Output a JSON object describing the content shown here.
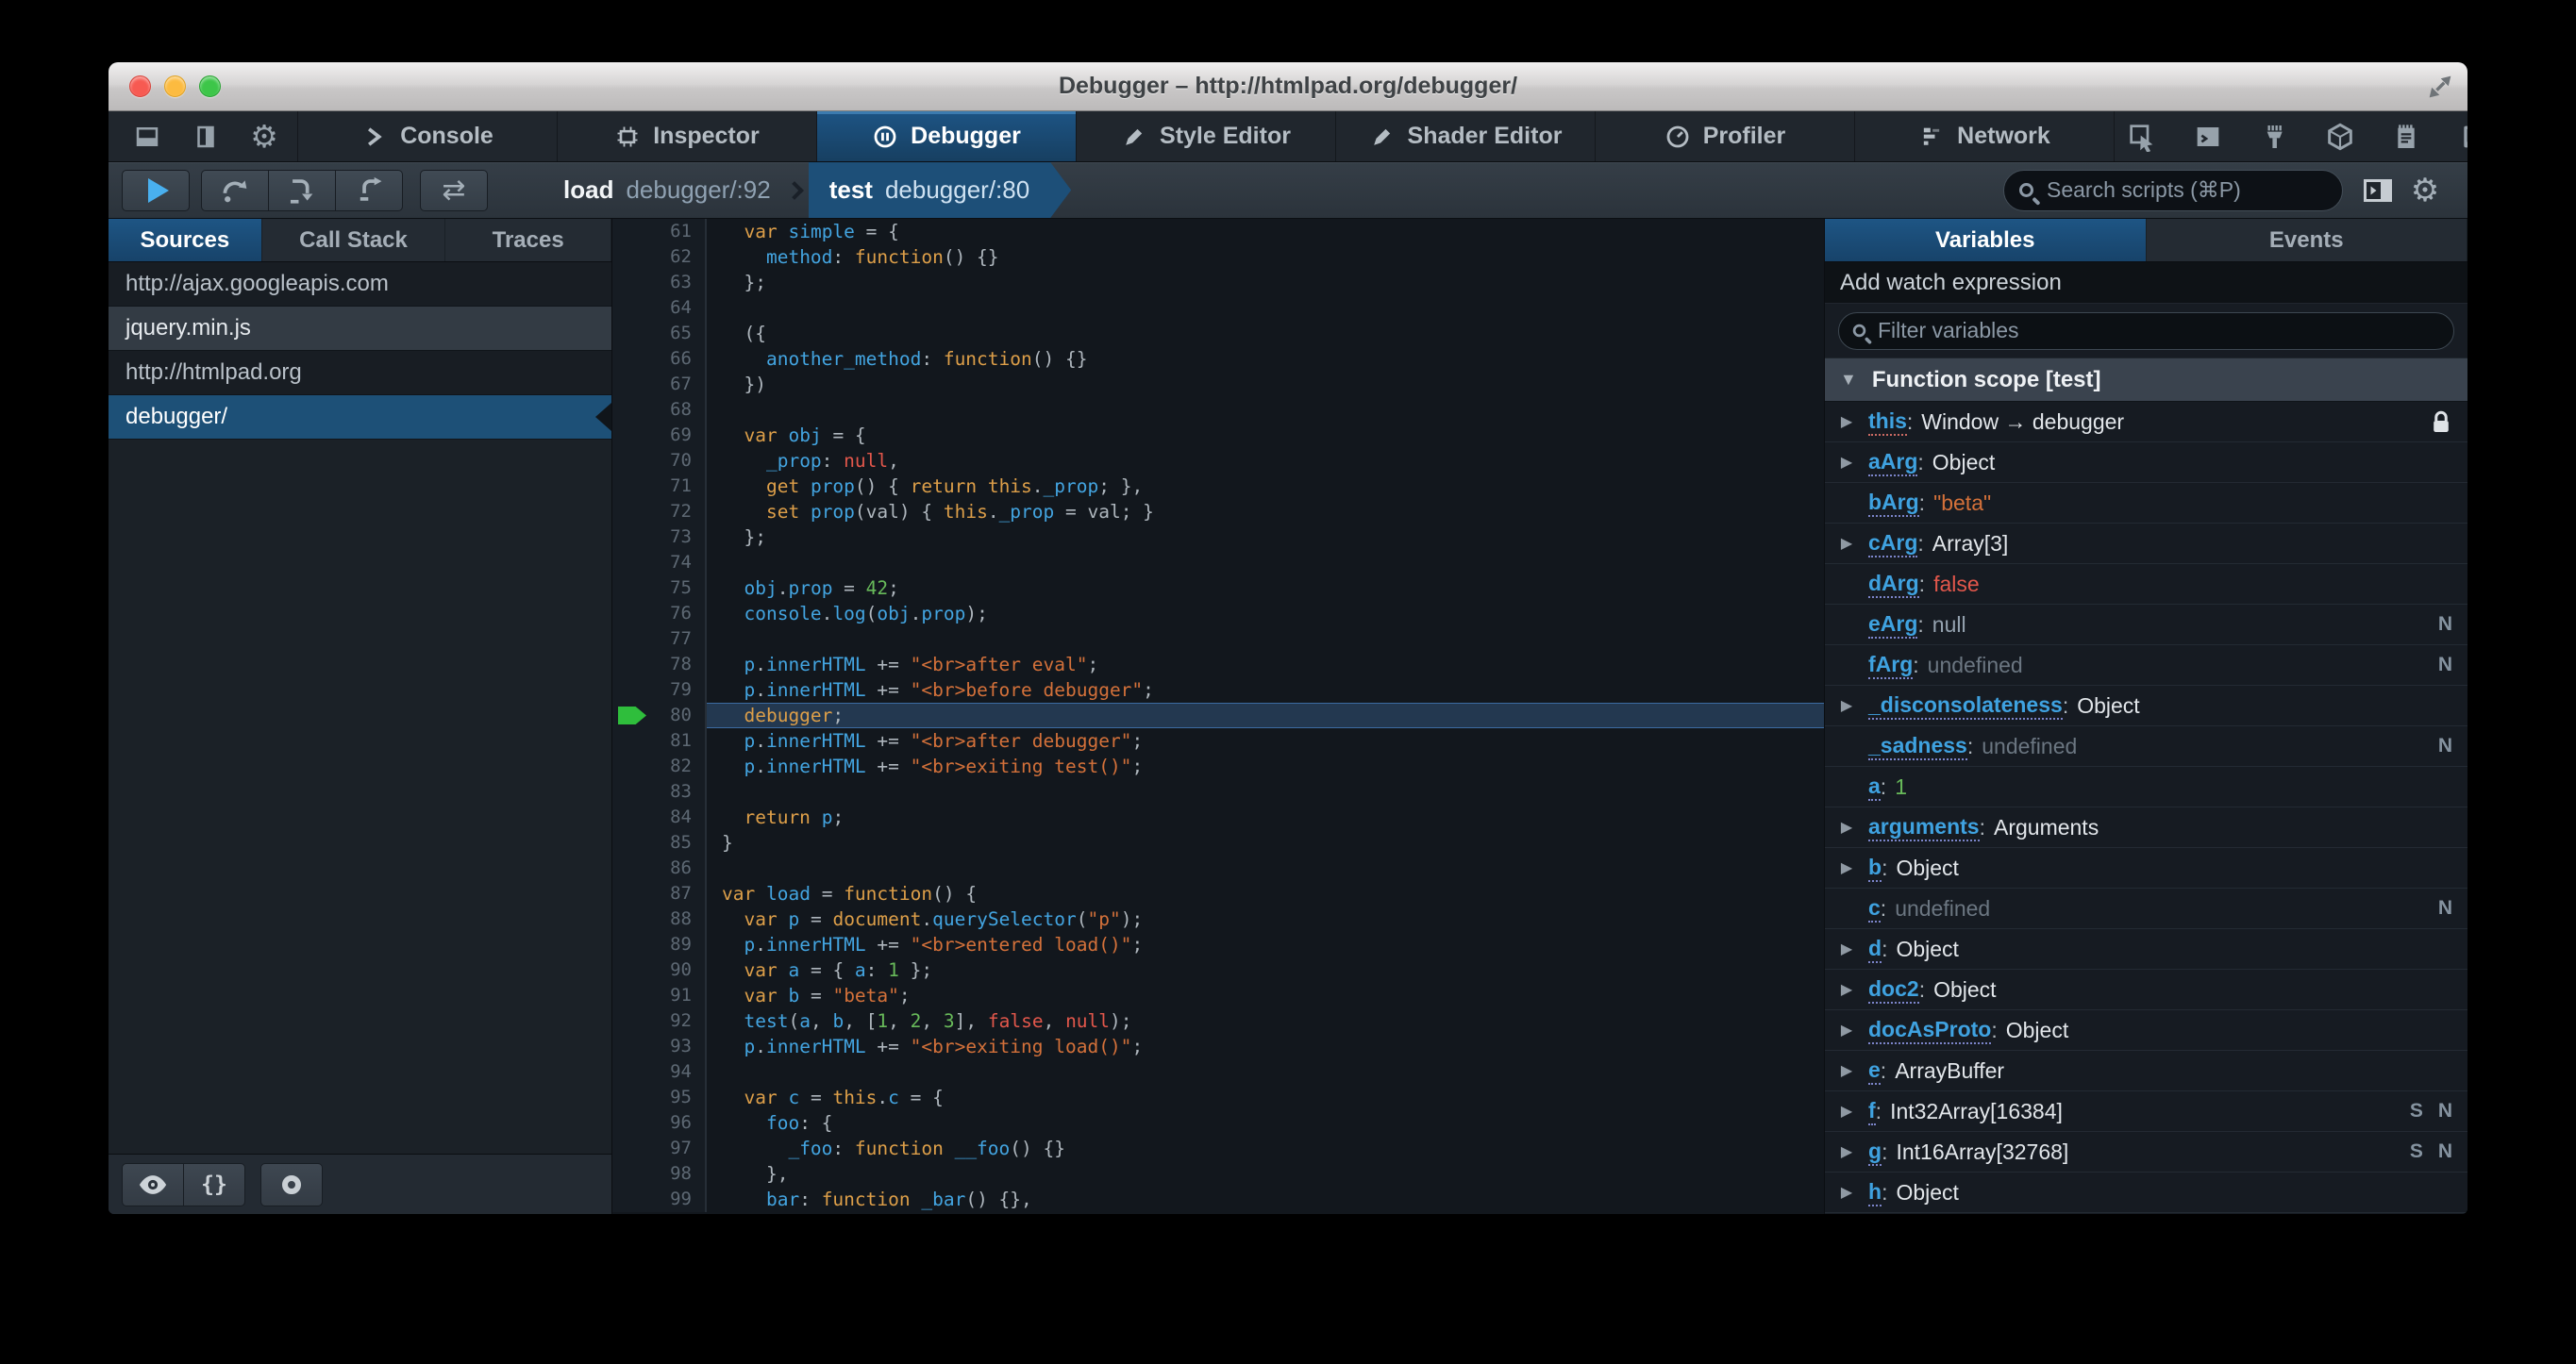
{
  "window": {
    "title": "Debugger – http://htmlpad.org/debugger/"
  },
  "colors": {
    "accent_blue": "#1d5077",
    "tab_blue": "#1d5484",
    "paused_green": "#2fbe3c",
    "keyword": "#dd9f49",
    "identifier": "#43a4e0",
    "string": "#d4713a",
    "number": "#68ba5a",
    "atom": "#e2574b"
  },
  "toolbar": {
    "left_buttons": [
      {
        "icon": "dock-bottom-icon"
      },
      {
        "icon": "dock-side-icon"
      },
      {
        "icon": "gear-icon"
      }
    ],
    "tabs": [
      {
        "id": "console",
        "label": "Console",
        "icon": "console-icon",
        "active": false
      },
      {
        "id": "inspector",
        "label": "Inspector",
        "icon": "inspector-icon",
        "active": false
      },
      {
        "id": "debugger",
        "label": "Debugger",
        "icon": "debugger-icon",
        "active": true
      },
      {
        "id": "style-editor",
        "label": "Style Editor",
        "icon": "style-editor-icon",
        "active": false
      },
      {
        "id": "shader-editor",
        "label": "Shader Editor",
        "icon": "shader-editor-icon",
        "active": false
      },
      {
        "id": "profiler",
        "label": "Profiler",
        "icon": "profiler-icon",
        "active": false
      },
      {
        "id": "network",
        "label": "Network",
        "icon": "network-icon",
        "active": false
      }
    ],
    "right_buttons": [
      {
        "icon": "pick-element-icon"
      },
      {
        "icon": "split-console-icon"
      },
      {
        "icon": "clean-icon"
      },
      {
        "icon": "tilt-3d-icon"
      },
      {
        "icon": "scratchpad-icon"
      },
      {
        "icon": "responsive-mode-icon"
      }
    ]
  },
  "debug_toolbar": {
    "resume_icon": "resume-icon",
    "step_buttons": [
      {
        "icon": "step-over-icon"
      },
      {
        "icon": "step-in-icon"
      },
      {
        "icon": "step-out-icon"
      }
    ],
    "toggle_icon": "swap-arrows-icon",
    "breadcrumbs": [
      {
        "fn": "load",
        "loc": "debugger/:92",
        "active": false
      },
      {
        "fn": "test",
        "loc": "debugger/:80",
        "active": true
      }
    ],
    "search": {
      "placeholder": "Search scripts (⌘P)"
    },
    "right_buttons": [
      {
        "icon": "panel-toggle-icon"
      },
      {
        "icon": "gear-icon"
      }
    ]
  },
  "sources_panel": {
    "tabs": [
      {
        "label": "Sources",
        "active": true
      },
      {
        "label": "Call Stack",
        "active": false
      },
      {
        "label": "Traces",
        "active": false
      }
    ],
    "items": [
      {
        "label": "http://ajax.googleapis.com",
        "kind": "group",
        "selected": false
      },
      {
        "label": "jquery.min.js",
        "kind": "file",
        "selected": false
      },
      {
        "label": "http://htmlpad.org",
        "kind": "group",
        "selected": false
      },
      {
        "label": "debugger/",
        "kind": "file",
        "selected": true
      }
    ],
    "footer_buttons": [
      {
        "icon": "blackbox-eye-icon",
        "glyph": ""
      },
      {
        "icon": "pretty-print-icon",
        "glyph": "{}"
      },
      {
        "icon": "record-icon",
        "glyph": ""
      }
    ]
  },
  "editor": {
    "first_line": 61,
    "paused_line": 80,
    "lines": [
      [
        [
          "pl",
          "  "
        ],
        [
          "kw",
          "var"
        ],
        [
          "pl",
          " "
        ],
        [
          "id",
          "simple"
        ],
        [
          "pu",
          " = {"
        ]
      ],
      [
        [
          "pl",
          "    "
        ],
        [
          "id",
          "method"
        ],
        [
          "pu",
          ": "
        ],
        [
          "kw",
          "function"
        ],
        [
          "pu",
          "() {}"
        ]
      ],
      [
        [
          "pl",
          "  "
        ],
        [
          "pu",
          "};"
        ]
      ],
      [],
      [
        [
          "pl",
          "  "
        ],
        [
          "pu",
          "({"
        ]
      ],
      [
        [
          "pl",
          "    "
        ],
        [
          "id",
          "another_method"
        ],
        [
          "pu",
          ": "
        ],
        [
          "kw",
          "function"
        ],
        [
          "pu",
          "() {}"
        ]
      ],
      [
        [
          "pl",
          "  "
        ],
        [
          "pu",
          "})"
        ]
      ],
      [],
      [
        [
          "pl",
          "  "
        ],
        [
          "kw",
          "var"
        ],
        [
          "pl",
          " "
        ],
        [
          "id",
          "obj"
        ],
        [
          "pu",
          " = {"
        ]
      ],
      [
        [
          "pl",
          "    "
        ],
        [
          "id",
          "_prop"
        ],
        [
          "pu",
          ": "
        ],
        [
          "at",
          "null"
        ],
        [
          "pu",
          ","
        ]
      ],
      [
        [
          "pl",
          "    "
        ],
        [
          "kw",
          "get"
        ],
        [
          "pl",
          " "
        ],
        [
          "id",
          "prop"
        ],
        [
          "pu",
          "() { "
        ],
        [
          "kw",
          "return"
        ],
        [
          "pl",
          " "
        ],
        [
          "kw",
          "this"
        ],
        [
          "pu",
          "."
        ],
        [
          "id",
          "_prop"
        ],
        [
          "pu",
          "; },"
        ]
      ],
      [
        [
          "pl",
          "    "
        ],
        [
          "kw",
          "set"
        ],
        [
          "pl",
          " "
        ],
        [
          "id",
          "prop"
        ],
        [
          "pu",
          "(val) { "
        ],
        [
          "kw",
          "this"
        ],
        [
          "pu",
          "."
        ],
        [
          "id",
          "_prop"
        ],
        [
          "pu",
          " = val; }"
        ]
      ],
      [
        [
          "pl",
          "  "
        ],
        [
          "pu",
          "};"
        ]
      ],
      [],
      [
        [
          "pl",
          "  "
        ],
        [
          "id",
          "obj"
        ],
        [
          "pu",
          "."
        ],
        [
          "id",
          "prop"
        ],
        [
          "pu",
          " = "
        ],
        [
          "nu",
          "42"
        ],
        [
          "pu",
          ";"
        ]
      ],
      [
        [
          "pl",
          "  "
        ],
        [
          "id",
          "console"
        ],
        [
          "pu",
          "."
        ],
        [
          "id",
          "log"
        ],
        [
          "pu",
          "("
        ],
        [
          "id",
          "obj"
        ],
        [
          "pu",
          "."
        ],
        [
          "id",
          "prop"
        ],
        [
          "pu",
          ");"
        ]
      ],
      [],
      [
        [
          "pl",
          "  "
        ],
        [
          "id",
          "p"
        ],
        [
          "pu",
          "."
        ],
        [
          "id",
          "innerHTML"
        ],
        [
          "pu",
          " += "
        ],
        [
          "st",
          "\"<br>after eval\""
        ],
        [
          "pu",
          ";"
        ]
      ],
      [
        [
          "pl",
          "  "
        ],
        [
          "id",
          "p"
        ],
        [
          "pu",
          "."
        ],
        [
          "id",
          "innerHTML"
        ],
        [
          "pu",
          " += "
        ],
        [
          "st",
          "\"<br>before debugger\""
        ],
        [
          "pu",
          ";"
        ]
      ],
      [
        [
          "pl",
          "  "
        ],
        [
          "kw",
          "debugger"
        ],
        [
          "pu",
          ";"
        ]
      ],
      [
        [
          "pl",
          "  "
        ],
        [
          "id",
          "p"
        ],
        [
          "pu",
          "."
        ],
        [
          "id",
          "innerHTML"
        ],
        [
          "pu",
          " += "
        ],
        [
          "st",
          "\"<br>after debugger\""
        ],
        [
          "pu",
          ";"
        ]
      ],
      [
        [
          "pl",
          "  "
        ],
        [
          "id",
          "p"
        ],
        [
          "pu",
          "."
        ],
        [
          "id",
          "innerHTML"
        ],
        [
          "pu",
          " += "
        ],
        [
          "st",
          "\"<br>exiting test()\""
        ],
        [
          "pu",
          ";"
        ]
      ],
      [],
      [
        [
          "pl",
          "  "
        ],
        [
          "kw",
          "return"
        ],
        [
          "pl",
          " "
        ],
        [
          "id",
          "p"
        ],
        [
          "pu",
          ";"
        ]
      ],
      [
        [
          "pu",
          "}"
        ]
      ],
      [],
      [
        [
          "kw",
          "var"
        ],
        [
          "pl",
          " "
        ],
        [
          "id",
          "load"
        ],
        [
          "pu",
          " = "
        ],
        [
          "kw",
          "function"
        ],
        [
          "pu",
          "() {"
        ]
      ],
      [
        [
          "pl",
          "  "
        ],
        [
          "kw",
          "var"
        ],
        [
          "pl",
          " "
        ],
        [
          "id",
          "p"
        ],
        [
          "pu",
          " = "
        ],
        [
          "kw",
          "document"
        ],
        [
          "pu",
          "."
        ],
        [
          "id",
          "querySelector"
        ],
        [
          "pu",
          "("
        ],
        [
          "st",
          "\"p\""
        ],
        [
          "pu",
          ");"
        ]
      ],
      [
        [
          "pl",
          "  "
        ],
        [
          "id",
          "p"
        ],
        [
          "pu",
          "."
        ],
        [
          "id",
          "innerHTML"
        ],
        [
          "pu",
          " += "
        ],
        [
          "st",
          "\"<br>entered load()\""
        ],
        [
          "pu",
          ";"
        ]
      ],
      [
        [
          "pl",
          "  "
        ],
        [
          "kw",
          "var"
        ],
        [
          "pl",
          " "
        ],
        [
          "id",
          "a"
        ],
        [
          "pu",
          " = { "
        ],
        [
          "id",
          "a"
        ],
        [
          "pu",
          ": "
        ],
        [
          "nu",
          "1"
        ],
        [
          "pu",
          " };"
        ]
      ],
      [
        [
          "pl",
          "  "
        ],
        [
          "kw",
          "var"
        ],
        [
          "pl",
          " "
        ],
        [
          "id",
          "b"
        ],
        [
          "pu",
          " = "
        ],
        [
          "st",
          "\"beta\""
        ],
        [
          "pu",
          ";"
        ]
      ],
      [
        [
          "pl",
          "  "
        ],
        [
          "id",
          "test"
        ],
        [
          "pu",
          "("
        ],
        [
          "id",
          "a"
        ],
        [
          "pu",
          ", "
        ],
        [
          "id",
          "b"
        ],
        [
          "pu",
          ", ["
        ],
        [
          "nu",
          "1"
        ],
        [
          "pu",
          ", "
        ],
        [
          "nu",
          "2"
        ],
        [
          "pu",
          ", "
        ],
        [
          "nu",
          "3"
        ],
        [
          "pu",
          "], "
        ],
        [
          "at",
          "false"
        ],
        [
          "pu",
          ", "
        ],
        [
          "at",
          "null"
        ],
        [
          "pu",
          ");"
        ]
      ],
      [
        [
          "pl",
          "  "
        ],
        [
          "id",
          "p"
        ],
        [
          "pu",
          "."
        ],
        [
          "id",
          "innerHTML"
        ],
        [
          "pu",
          " += "
        ],
        [
          "st",
          "\"<br>exiting load()\""
        ],
        [
          "pu",
          ";"
        ]
      ],
      [],
      [
        [
          "pl",
          "  "
        ],
        [
          "kw",
          "var"
        ],
        [
          "pl",
          " "
        ],
        [
          "id",
          "c"
        ],
        [
          "pu",
          " = "
        ],
        [
          "kw",
          "this"
        ],
        [
          "pu",
          "."
        ],
        [
          "id",
          "c"
        ],
        [
          "pu",
          " = {"
        ]
      ],
      [
        [
          "pl",
          "    "
        ],
        [
          "id",
          "foo"
        ],
        [
          "pu",
          ": {"
        ]
      ],
      [
        [
          "pl",
          "      "
        ],
        [
          "id",
          "_foo"
        ],
        [
          "pu",
          ": "
        ],
        [
          "kw",
          "function"
        ],
        [
          "pl",
          " "
        ],
        [
          "id",
          "__foo"
        ],
        [
          "pu",
          "() {}"
        ]
      ],
      [
        [
          "pl",
          "    "
        ],
        [
          "pu",
          "},"
        ]
      ],
      [
        [
          "pl",
          "    "
        ],
        [
          "id",
          "bar"
        ],
        [
          "pu",
          ": "
        ],
        [
          "kw",
          "function"
        ],
        [
          "pl",
          " "
        ],
        [
          "id",
          "_bar"
        ],
        [
          "pu",
          "() {},"
        ]
      ]
    ]
  },
  "variables_panel": {
    "tabs": [
      {
        "label": "Variables",
        "active": true
      },
      {
        "label": "Events",
        "active": false
      }
    ],
    "watch_placeholder": "Add watch expression",
    "filter": {
      "placeholder": "Filter variables"
    },
    "scope_header": "Function scope [test]",
    "rows": [
      {
        "expandable": true,
        "name": "this",
        "value": "Window → debugger",
        "vtype": "obj",
        "badges": [],
        "lock": true,
        "nameStyle": "this"
      },
      {
        "expandable": true,
        "name": "aArg",
        "value": "Object",
        "vtype": "obj",
        "badges": [],
        "lock": false,
        "nameStyle": ""
      },
      {
        "expandable": false,
        "name": "bArg",
        "value": "\"beta\"",
        "vtype": "str",
        "badges": [],
        "lock": false,
        "nameStyle": ""
      },
      {
        "expandable": true,
        "name": "cArg",
        "value": "Array[3]",
        "vtype": "obj",
        "badges": [],
        "lock": false,
        "nameStyle": ""
      },
      {
        "expandable": false,
        "name": "dArg",
        "value": "false",
        "vtype": "bool",
        "badges": [],
        "lock": false,
        "nameStyle": ""
      },
      {
        "expandable": false,
        "name": "eArg",
        "value": "null",
        "vtype": "null",
        "badges": [
          "N"
        ],
        "lock": false,
        "nameStyle": ""
      },
      {
        "expandable": false,
        "name": "fArg",
        "value": "undefined",
        "vtype": "undef",
        "badges": [
          "N"
        ],
        "lock": false,
        "nameStyle": ""
      },
      {
        "expandable": true,
        "name": "_disconsolateness",
        "value": "Object",
        "vtype": "obj",
        "badges": [],
        "lock": false,
        "nameStyle": ""
      },
      {
        "expandable": false,
        "name": "_sadness",
        "value": "undefined",
        "vtype": "undef",
        "badges": [
          "N"
        ],
        "lock": false,
        "nameStyle": ""
      },
      {
        "expandable": false,
        "name": "a",
        "value": "1",
        "vtype": "num",
        "badges": [],
        "lock": false,
        "nameStyle": ""
      },
      {
        "expandable": true,
        "name": "arguments",
        "value": "Arguments",
        "vtype": "obj",
        "badges": [],
        "lock": false,
        "nameStyle": ""
      },
      {
        "expandable": true,
        "name": "b",
        "value": "Object",
        "vtype": "obj",
        "badges": [],
        "lock": false,
        "nameStyle": ""
      },
      {
        "expandable": false,
        "name": "c",
        "value": "undefined",
        "vtype": "undef",
        "badges": [
          "N"
        ],
        "lock": false,
        "nameStyle": ""
      },
      {
        "expandable": true,
        "name": "d",
        "value": "Object",
        "vtype": "obj",
        "badges": [],
        "lock": false,
        "nameStyle": ""
      },
      {
        "expandable": true,
        "name": "doc2",
        "value": "Object",
        "vtype": "obj",
        "badges": [],
        "lock": false,
        "nameStyle": ""
      },
      {
        "expandable": true,
        "name": "docAsProto",
        "value": "Object",
        "vtype": "obj",
        "badges": [],
        "lock": false,
        "nameStyle": ""
      },
      {
        "expandable": true,
        "name": "e",
        "value": "ArrayBuffer",
        "vtype": "obj",
        "badges": [],
        "lock": false,
        "nameStyle": ""
      },
      {
        "expandable": true,
        "name": "f",
        "value": "Int32Array[16384]",
        "vtype": "obj",
        "badges": [
          "S",
          "N"
        ],
        "lock": false,
        "nameStyle": ""
      },
      {
        "expandable": true,
        "name": "g",
        "value": "Int16Array[32768]",
        "vtype": "obj",
        "badges": [
          "S",
          "N"
        ],
        "lock": false,
        "nameStyle": ""
      },
      {
        "expandable": true,
        "name": "h",
        "value": "Object",
        "vtype": "obj",
        "badges": [],
        "lock": false,
        "nameStyle": ""
      }
    ]
  }
}
